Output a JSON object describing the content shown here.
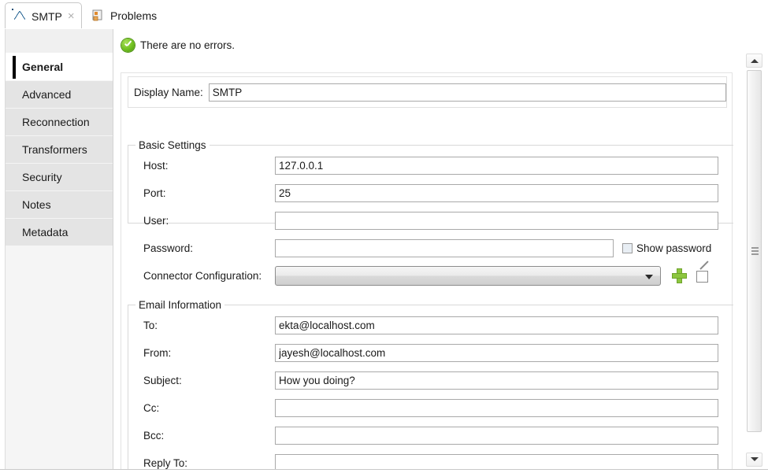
{
  "window": {
    "title": "SMTP"
  },
  "tabs": [
    {
      "label": "SMTP",
      "icon": "envelope-icon",
      "active": true,
      "closable": true,
      "close_glyph": "×"
    },
    {
      "label": "Problems",
      "icon": "problems-icon",
      "active": false,
      "closable": false
    }
  ],
  "sidebar": {
    "items": [
      {
        "label": "General",
        "selected": true
      },
      {
        "label": "Advanced",
        "selected": false
      },
      {
        "label": "Reconnection",
        "selected": false
      },
      {
        "label": "Transformers",
        "selected": false
      },
      {
        "label": "Security",
        "selected": false
      },
      {
        "label": "Notes",
        "selected": false
      },
      {
        "label": "Metadata",
        "selected": false
      }
    ]
  },
  "status": {
    "icon": "success-check-icon",
    "text": "There are no errors.",
    "color": "#6fbf1f"
  },
  "display_name": {
    "label": "Display Name:",
    "value": "SMTP",
    "placeholder": ""
  },
  "basic_settings": {
    "title": "Basic Settings",
    "fields": [
      {
        "label": "Host:",
        "value": "127.0.0.1",
        "placeholder": ""
      },
      {
        "label": "Port:",
        "value": "25",
        "placeholder": ""
      },
      {
        "label": "User:",
        "value": "",
        "placeholder": ""
      },
      {
        "label": "Password:",
        "value": "",
        "placeholder": ""
      }
    ],
    "show_password": {
      "label": "Show password",
      "checked": false
    },
    "connector_configuration": {
      "label": "Connector Configuration:",
      "value": "",
      "add_button": "add-icon",
      "edit_button": "edit-icon"
    }
  },
  "email_information": {
    "title": "Email Information",
    "fields": [
      {
        "label": "To:",
        "value": "ekta@localhost.com",
        "placeholder": ""
      },
      {
        "label": "From:",
        "value": "jayesh@localhost.com",
        "placeholder": ""
      },
      {
        "label": "Subject:",
        "value": "How you doing?",
        "placeholder": ""
      },
      {
        "label": "Cc:",
        "value": "",
        "placeholder": ""
      },
      {
        "label": "Bcc:",
        "value": "",
        "placeholder": ""
      },
      {
        "label": "Reply To:",
        "value": "",
        "placeholder": ""
      }
    ]
  },
  "scrollbar": {
    "up_arrow": "chevron-up-icon",
    "down_arrow": "chevron-down-icon",
    "thumb": "scrollbar-thumb"
  },
  "colors": {
    "accent_blue": "#1c5d8f",
    "success_green": "#6fbf1f",
    "add_green": "#8cc63f",
    "sidebar_bg": "#e4e4e4",
    "selected_bg": "#ffffff"
  }
}
